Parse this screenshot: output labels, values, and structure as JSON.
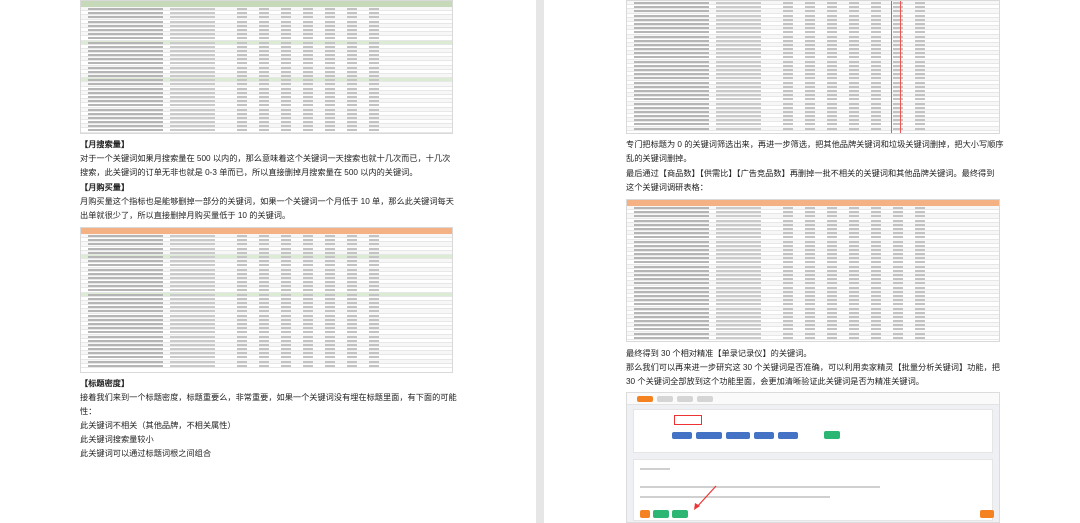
{
  "left": {
    "month_search": {
      "heading": "【月搜索量】",
      "lines": [
        "对于一个关键词如果月搜索量在 500 以内的，那么意味着这个关键词一天搜索也就十几次而已，十几次",
        "搜索，此关键词的订单无非也就是 0-3 单而已，所以直接删掉月搜索量在 500 以内的关键词。"
      ]
    },
    "month_purchase": {
      "heading": "【月购买量】",
      "lines": [
        "月购买量这个指标也是能够删掉一部分的关键词，如果一个关键词一个月低于 10 单，那么此关键词每天",
        "出单就很少了，所以直接删掉月购买量低于 10 的关键词。"
      ]
    },
    "title_density": {
      "heading": "【标题密度】",
      "lines": [
        "接着我们来到一个标题密度，标题重要么，非常重要，如果一个关键词没有埋在标题里面，有下面的可能",
        "性："
      ],
      "items": [
        "此关键词不相关（其他品牌，不相关属性）",
        "此关键词搜索量较小",
        "此关键词可以通过标题词根之间组合"
      ]
    }
  },
  "right": {
    "para1": [
      "专门把标题为 0 的关键词筛选出来，再进一步筛选，把其他品牌关键词和垃圾关键词删掉，把大小写顺序",
      "乱的关键词删掉。"
    ],
    "para2": [
      "最后通过【商品数】【供需比】【广告竞品数】再删掉一批不相关的关键词和其他品牌关键词。最终得到",
      "这个关键词调研表格："
    ],
    "para3": [
      "最终得到 30 个相对精准【单录记录仪】的关键词。",
      "那么我们可以再来进一步研究这 30 个关键词是否准确，可以利用卖家精灵【批量分析关键词】功能，把",
      "30 个关键词全部放到这个功能里面，会更加清晰验证此关键词是否为精准关键词。"
    ]
  },
  "colors": {
    "sheet_header_green": "#c6d9b8",
    "sheet_header_orange": "#f4b183",
    "highlight_red": "#e33333",
    "button_green": "#2bb673",
    "button_orange": "#f58220",
    "chip_blue": "#4472c4"
  }
}
